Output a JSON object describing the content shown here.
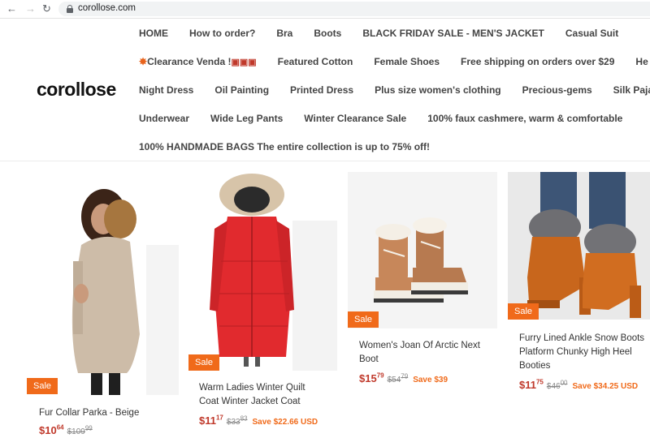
{
  "browser": {
    "url": "corollose.com"
  },
  "site": {
    "logo": "corollose"
  },
  "nav": {
    "row1": [
      "HOME",
      "How to order?",
      "Bra",
      "Boots",
      "BLACK FRIDAY SALE - MEN'S JACKET",
      "Casual Suit"
    ],
    "row2_first": "Clearance Venda !",
    "row2": [
      "Featured Cotton",
      "Female Shoes",
      "Free shipping on orders over $29",
      "He"
    ],
    "row3": [
      "Night Dress",
      "Oil Painting",
      "Printed Dress",
      "Plus size women's clothing",
      "Precious-gems",
      "Silk Pajam"
    ],
    "row4": [
      "Underwear",
      "Wide Leg Pants",
      "Winter Clearance Sale",
      "100% faux cashmere, warm & comfortable"
    ],
    "row5": [
      "100% HANDMADE BAGS The entire collection is up to 75% off!"
    ]
  },
  "products": [
    {
      "title": "Fur Collar Parka - Beige",
      "sale_label": "Sale",
      "price_main": "$10",
      "price_cents": "64",
      "old_main": "$109",
      "old_cents": "99",
      "save": ""
    },
    {
      "title": "Warm Ladies Winter Quilt Coat Winter Jacket Coat",
      "sale_label": "Sale",
      "price_main": "$11",
      "price_cents": "17",
      "old_main": "$33",
      "old_cents": "83",
      "save": "Save $22.66 USD"
    },
    {
      "title": "Women's Joan Of Arctic Next Boot",
      "sale_label": "Sale",
      "price_main": "$15",
      "price_cents": "79",
      "old_main": "$54",
      "old_cents": "79",
      "save": "Save $39"
    },
    {
      "title": "Furry Lined Ankle Snow Boots Platform Chunky High Heel Booties",
      "sale_label": "Sale",
      "price_main": "$11",
      "price_cents": "75",
      "old_main": "$46",
      "old_cents": "00",
      "save": "Save $34.25 USD"
    }
  ],
  "colors": {
    "sale_badge": "#f06a1a",
    "price": "#c0392b"
  }
}
